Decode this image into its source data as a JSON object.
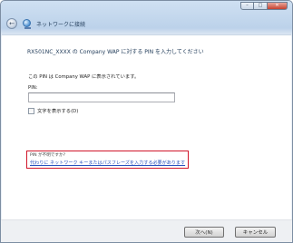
{
  "window": {
    "title": "ネットワークに接続",
    "caption_buttons": {
      "minimize": "–",
      "maximize": "□",
      "close": "✕"
    }
  },
  "main": {
    "heading": "RX501NC_XXXX の Company WAP に対する PIN を入力してください",
    "description": "この PIN は Company WAP に表示されています。",
    "pin_label": "PIN:",
    "pin_value": "",
    "show_characters_label": "文字を表示する(D)",
    "show_characters_checked": false,
    "hint_question": "PIN が不明ですか?",
    "hint_link": "代わりに ネットワーク キーまたはパスフレーズを入力する必要があります"
  },
  "footer": {
    "next_label": "次へ(N)",
    "cancel_label": "キャンセル"
  },
  "colors": {
    "highlight_border": "#d0162a",
    "link": "#2a52be",
    "heading": "#1e3957"
  }
}
